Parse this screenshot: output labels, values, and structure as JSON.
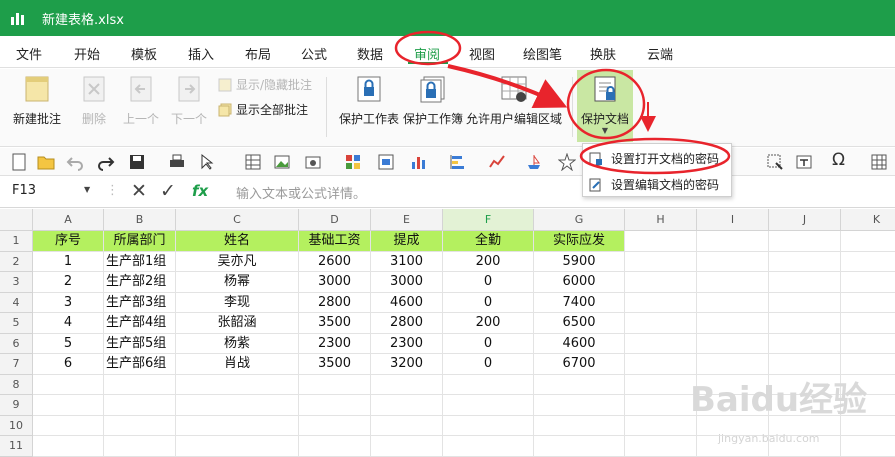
{
  "window": {
    "title": "新建表格.xlsx",
    "accent": "#1e9e4a"
  },
  "menu": [
    "文件",
    "开始",
    "模板",
    "插入",
    "布局",
    "公式",
    "数据",
    "审阅",
    "视图",
    "绘图笔",
    "换肤",
    "云端"
  ],
  "menu_active_index": 7,
  "ribbon": {
    "new_comment": "新建批注",
    "delete": "删除",
    "prev": "上一个",
    "next": "下一个",
    "show_hide_comment": "显示/隐藏批注",
    "show_all_comments": "显示全部批注",
    "protect_sheet": "保护工作表",
    "protect_workbook": "保护工作簿",
    "allow_edit_ranges": "允许用户编辑区域",
    "protect_document": "保护文档"
  },
  "dropdown": {
    "set_open_password": "设置打开文档的密码",
    "set_edit_password": "设置编辑文档的密码"
  },
  "formula": {
    "name_box": "F13",
    "placeholder": "输入文本或公式详情。",
    "fx": "fx"
  },
  "sheet": {
    "columns": [
      "A",
      "B",
      "C",
      "D",
      "E",
      "F",
      "G",
      "H",
      "I",
      "J",
      "K"
    ],
    "selected_column": "F",
    "rows": [
      "1",
      "2",
      "3",
      "4",
      "5",
      "6",
      "7",
      "8",
      "9",
      "10",
      "11"
    ],
    "header": [
      "序号",
      "所属部门",
      "姓名",
      "基础工资",
      "提成",
      "全勤",
      "实际应发"
    ],
    "data": [
      [
        "1",
        "生产部1组",
        "吴亦凡",
        "2600",
        "3100",
        "200",
        "5900"
      ],
      [
        "2",
        "生产部2组",
        "杨幂",
        "3000",
        "3000",
        "0",
        "6000"
      ],
      [
        "3",
        "生产部3组",
        "李现",
        "2800",
        "4600",
        "0",
        "7400"
      ],
      [
        "4",
        "生产部4组",
        "张韶涵",
        "3500",
        "2800",
        "200",
        "6500"
      ],
      [
        "5",
        "生产部5组",
        "杨紫",
        "2300",
        "2300",
        "0",
        "4600"
      ],
      [
        "6",
        "生产部6组",
        "肖战",
        "3500",
        "3200",
        "0",
        "6700"
      ]
    ],
    "header_fill": "#b4f05f"
  },
  "watermark": {
    "main": "Baidu经验",
    "sub": "jingyan.baidu.com"
  }
}
